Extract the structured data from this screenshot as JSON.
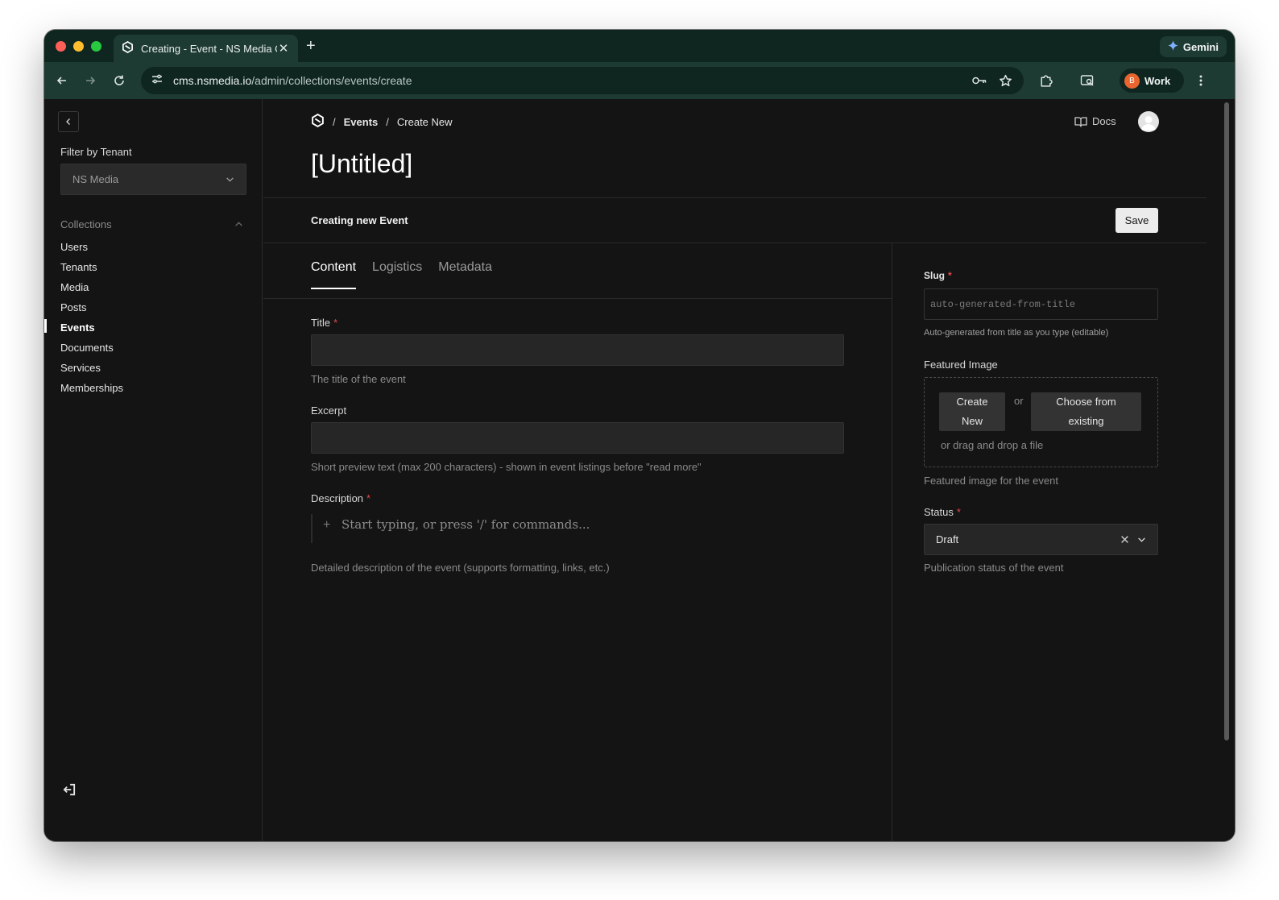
{
  "browser": {
    "tab_title": "Creating - Event - NS Media CMS",
    "new_tab_label": "+",
    "close_label": "✕",
    "gemini_label": "Gemini",
    "url_host": "cms.nsmedia.io",
    "url_path": "/admin/collections/events/create",
    "profile_initial": "B",
    "profile_label": "Work",
    "colors": {
      "titlebar": "#0f2620",
      "toolbar": "#1d3a33",
      "profile": "#e8652f"
    }
  },
  "sidebar": {
    "filter_label": "Filter by Tenant",
    "tenant_value": "NS Media",
    "collections_label": "Collections",
    "items": [
      {
        "label": "Users",
        "active": false
      },
      {
        "label": "Tenants",
        "active": false
      },
      {
        "label": "Media",
        "active": false
      },
      {
        "label": "Posts",
        "active": false
      },
      {
        "label": "Events",
        "active": true
      },
      {
        "label": "Documents",
        "active": false
      },
      {
        "label": "Services",
        "active": false
      },
      {
        "label": "Memberships",
        "active": false
      }
    ]
  },
  "header": {
    "breadcrumb_sep": "/",
    "breadcrumb_collection": "Events",
    "breadcrumb_current": "Create New",
    "docs_label": "Docs",
    "page_title": "[Untitled]",
    "status_text": "Creating new Event",
    "save_label": "Save"
  },
  "tabs": [
    {
      "label": "Content",
      "active": true
    },
    {
      "label": "Logistics",
      "active": false
    },
    {
      "label": "Metadata",
      "active": false
    }
  ],
  "fields": {
    "title": {
      "label": "Title",
      "required": "*",
      "value": "",
      "help": "The title of the event"
    },
    "excerpt": {
      "label": "Excerpt",
      "value": "",
      "help": "Short preview text (max 200 characters) - shown in event listings before \"read more\""
    },
    "description": {
      "label": "Description",
      "required": "*",
      "plus": "+",
      "placeholder": "Start typing, or press '/' for commands...",
      "help": "Detailed description of the event (supports formatting, links, etc.)"
    }
  },
  "side_fields": {
    "slug": {
      "label": "Slug",
      "required": "*",
      "placeholder": "auto-generated-from-title",
      "help": "Auto-generated from title as you type (editable)"
    },
    "featured_image": {
      "label": "Featured Image",
      "create_line1": "Create",
      "create_line2": "New",
      "or_label": "or",
      "choose_line1": "Choose from",
      "choose_line2": "existing",
      "drag_label": "or drag and drop a file",
      "help": "Featured image for the event"
    },
    "status": {
      "label": "Status",
      "required": "*",
      "value": "Draft",
      "help": "Publication status of the event"
    }
  }
}
